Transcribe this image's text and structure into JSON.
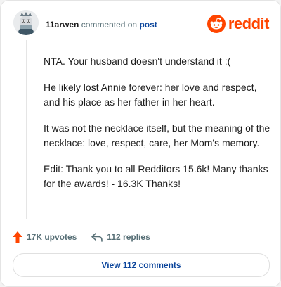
{
  "header": {
    "username": "11arwen",
    "action_text": "commented on",
    "post_link": "post"
  },
  "logo": {
    "wordmark": "reddit",
    "icon": "reddit-snoo-icon",
    "color": "#ff4500"
  },
  "comment": {
    "paragraphs": [
      "NTA. Your husband doesn't understand it :(",
      "He likely lost Annie forever: her love and respect, and his place as her father in her heart.",
      "It was not the necklace itself, but the meaning of the necklace: love, respect, care, her Mom's memory.",
      "Edit: Thank you to all Redditors 15.6k! Many thanks for the awards! - 16.3K Thanks!"
    ]
  },
  "actions": {
    "upvotes_label": "17K upvotes",
    "upvote_icon": "upvote-arrow-icon",
    "upvote_color": "#ff4500",
    "replies_label": "112 replies",
    "reply_icon": "reply-arrow-icon"
  },
  "view_button": {
    "label": "View 112 comments"
  }
}
